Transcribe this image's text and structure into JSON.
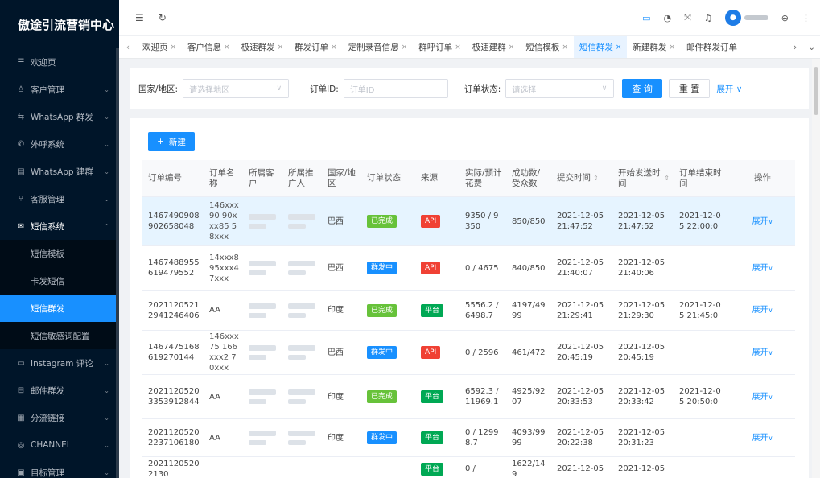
{
  "brand": "傲途引流营销中心",
  "sidebar": {
    "items": [
      {
        "label": "欢迎页",
        "icon": "menu-icon"
      },
      {
        "label": "客户管理",
        "icon": "user-icon"
      },
      {
        "label": "WhatsApp 群发",
        "icon": "transfer-icon"
      },
      {
        "label": "外呼系统",
        "icon": "phone-icon"
      },
      {
        "label": "WhatsApp 建群",
        "icon": "doc-icon"
      },
      {
        "label": "客服管理",
        "icon": "fork-icon"
      },
      {
        "label": "短信系统",
        "icon": "mail-icon"
      }
    ],
    "sub_items": [
      "短信模板",
      "卡发短信",
      "短信群发",
      "短信敏感词配置"
    ],
    "items_after": [
      {
        "label": "Instagram 评论",
        "icon": "monitor-icon"
      },
      {
        "label": "邮件群发",
        "icon": "envelope-icon"
      },
      {
        "label": "分流链接",
        "icon": "grid-icon"
      },
      {
        "label": "CHANNEL",
        "icon": "channel-icon"
      },
      {
        "label": "目标管理",
        "icon": "calendar-icon"
      }
    ]
  },
  "tabs": [
    "欢迎页",
    "客户信息",
    "极速群发",
    "群发订单",
    "定制录音信息",
    "群呼订单",
    "极速建群",
    "短信模板",
    "短信群发",
    "新建群发",
    "邮件群发订单"
  ],
  "active_tab": "短信群发",
  "filter": {
    "country_label": "国家/地区:",
    "country_placeholder": "请选择地区",
    "order_id_label": "订单ID:",
    "order_id_placeholder": "订单ID",
    "status_label": "订单状态:",
    "status_placeholder": "请选择",
    "search": "查 询",
    "reset": "重 置",
    "expand": "展开"
  },
  "new_button": "新建",
  "table": {
    "headers": [
      "订单编号",
      "订单名称",
      "所属客户",
      "所属推广人",
      "国家/地区",
      "订单状态",
      "来源",
      "实际/预计花费",
      "成功数/受众数",
      "提交时间",
      "开始发送时间",
      "订单结束时间",
      "操作"
    ],
    "rows": [
      {
        "id": "1467490908902658048",
        "name": "146xxx90 90xxx85 58xxx",
        "country": "巴西",
        "status": "已完成",
        "source": "API",
        "cost": "9350 / 9350",
        "success": "850/850",
        "submit": "2021-12-05 21:47:52",
        "start": "2021-12-05 21:47:52",
        "end": "2021-12-05 22:00:0",
        "op": "展开"
      },
      {
        "id": "1467488955619479552",
        "name": "14xxx8 95xxx4 7xxx",
        "country": "巴西",
        "status": "群发中",
        "source": "API",
        "cost": "0 / 4675",
        "success": "840/850",
        "submit": "2021-12-05 21:40:07",
        "start": "2021-12-05 21:40:06",
        "end": "",
        "op": "展开"
      },
      {
        "id": "20211205212941246406",
        "name": "AA",
        "country": "印度",
        "status": "已完成",
        "source": "平台",
        "cost": "5556.2 / 6498.7",
        "success": "4197/4999",
        "submit": "2021-12-05 21:29:41",
        "start": "2021-12-05 21:29:30",
        "end": "2021-12-05 21:45:0",
        "op": "展开"
      },
      {
        "id": "1467475168619270144",
        "name": "146xxx75 166xxx2 70xxx",
        "country": "巴西",
        "status": "群发中",
        "source": "API",
        "cost": "0 / 2596",
        "success": "461/472",
        "submit": "2021-12-05 20:45:19",
        "start": "2021-12-05 20:45:19",
        "end": "",
        "op": "展开"
      },
      {
        "id": "20211205203353912844",
        "name": "AA",
        "country": "印度",
        "status": "已完成",
        "source": "平台",
        "cost": "6592.3 / 11969.1",
        "success": "4925/9207",
        "submit": "2021-12-05 20:33:53",
        "start": "2021-12-05 20:33:42",
        "end": "2021-12-05 20:50:0",
        "op": "展开"
      },
      {
        "id": "20211205202237106180",
        "name": "AA",
        "country": "印度",
        "status": "群发中",
        "source": "平台",
        "cost": "0 / 12998.7",
        "success": "4093/9999",
        "submit": "2021-12-05 20:22:38",
        "start": "2021-12-05 20:31:23",
        "end": "",
        "op": "展开"
      },
      {
        "id": "20211205202130",
        "name": "",
        "country": "",
        "status": "",
        "source": "平台",
        "cost": "0 /",
        "success": "1622/149",
        "submit": "2021-12-05",
        "start": "2021-12-05",
        "end": "",
        "op": ""
      }
    ]
  },
  "colors": {
    "sidebar_bg": "#001529",
    "primary": "#1890ff",
    "done": "#67c23a",
    "sending": "#1890ff",
    "api": "#f04134",
    "platform": "#00a854"
  }
}
